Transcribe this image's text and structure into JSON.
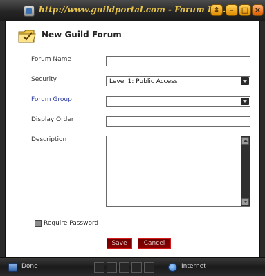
{
  "window": {
    "title": "http://www.guildportal.com - Forum Edi...",
    "buttons": {
      "menu": "⇕",
      "minimize": "–",
      "maximize": "□",
      "close": "×"
    }
  },
  "dialog": {
    "title": "New Guild Forum",
    "fields": {
      "forum_name": {
        "label": "Forum Name",
        "value": ""
      },
      "security": {
        "label": "Security",
        "selected": "Level 1: Public Access"
      },
      "forum_group": {
        "label": "Forum Group",
        "selected": ""
      },
      "display_order": {
        "label": "Display Order",
        "value": ""
      },
      "description": {
        "label": "Description",
        "value": ""
      }
    },
    "require_password": {
      "label": "Require Password",
      "checked": false
    },
    "buttons": {
      "save": "Save",
      "cancel": "Cancel"
    }
  },
  "status_bar": {
    "left_text": "Done",
    "zone_text": "Internet"
  },
  "colors": {
    "accent_gold": "#e6c34a",
    "link_blue": "#2b3c9f",
    "button_red": "#8b0000"
  }
}
